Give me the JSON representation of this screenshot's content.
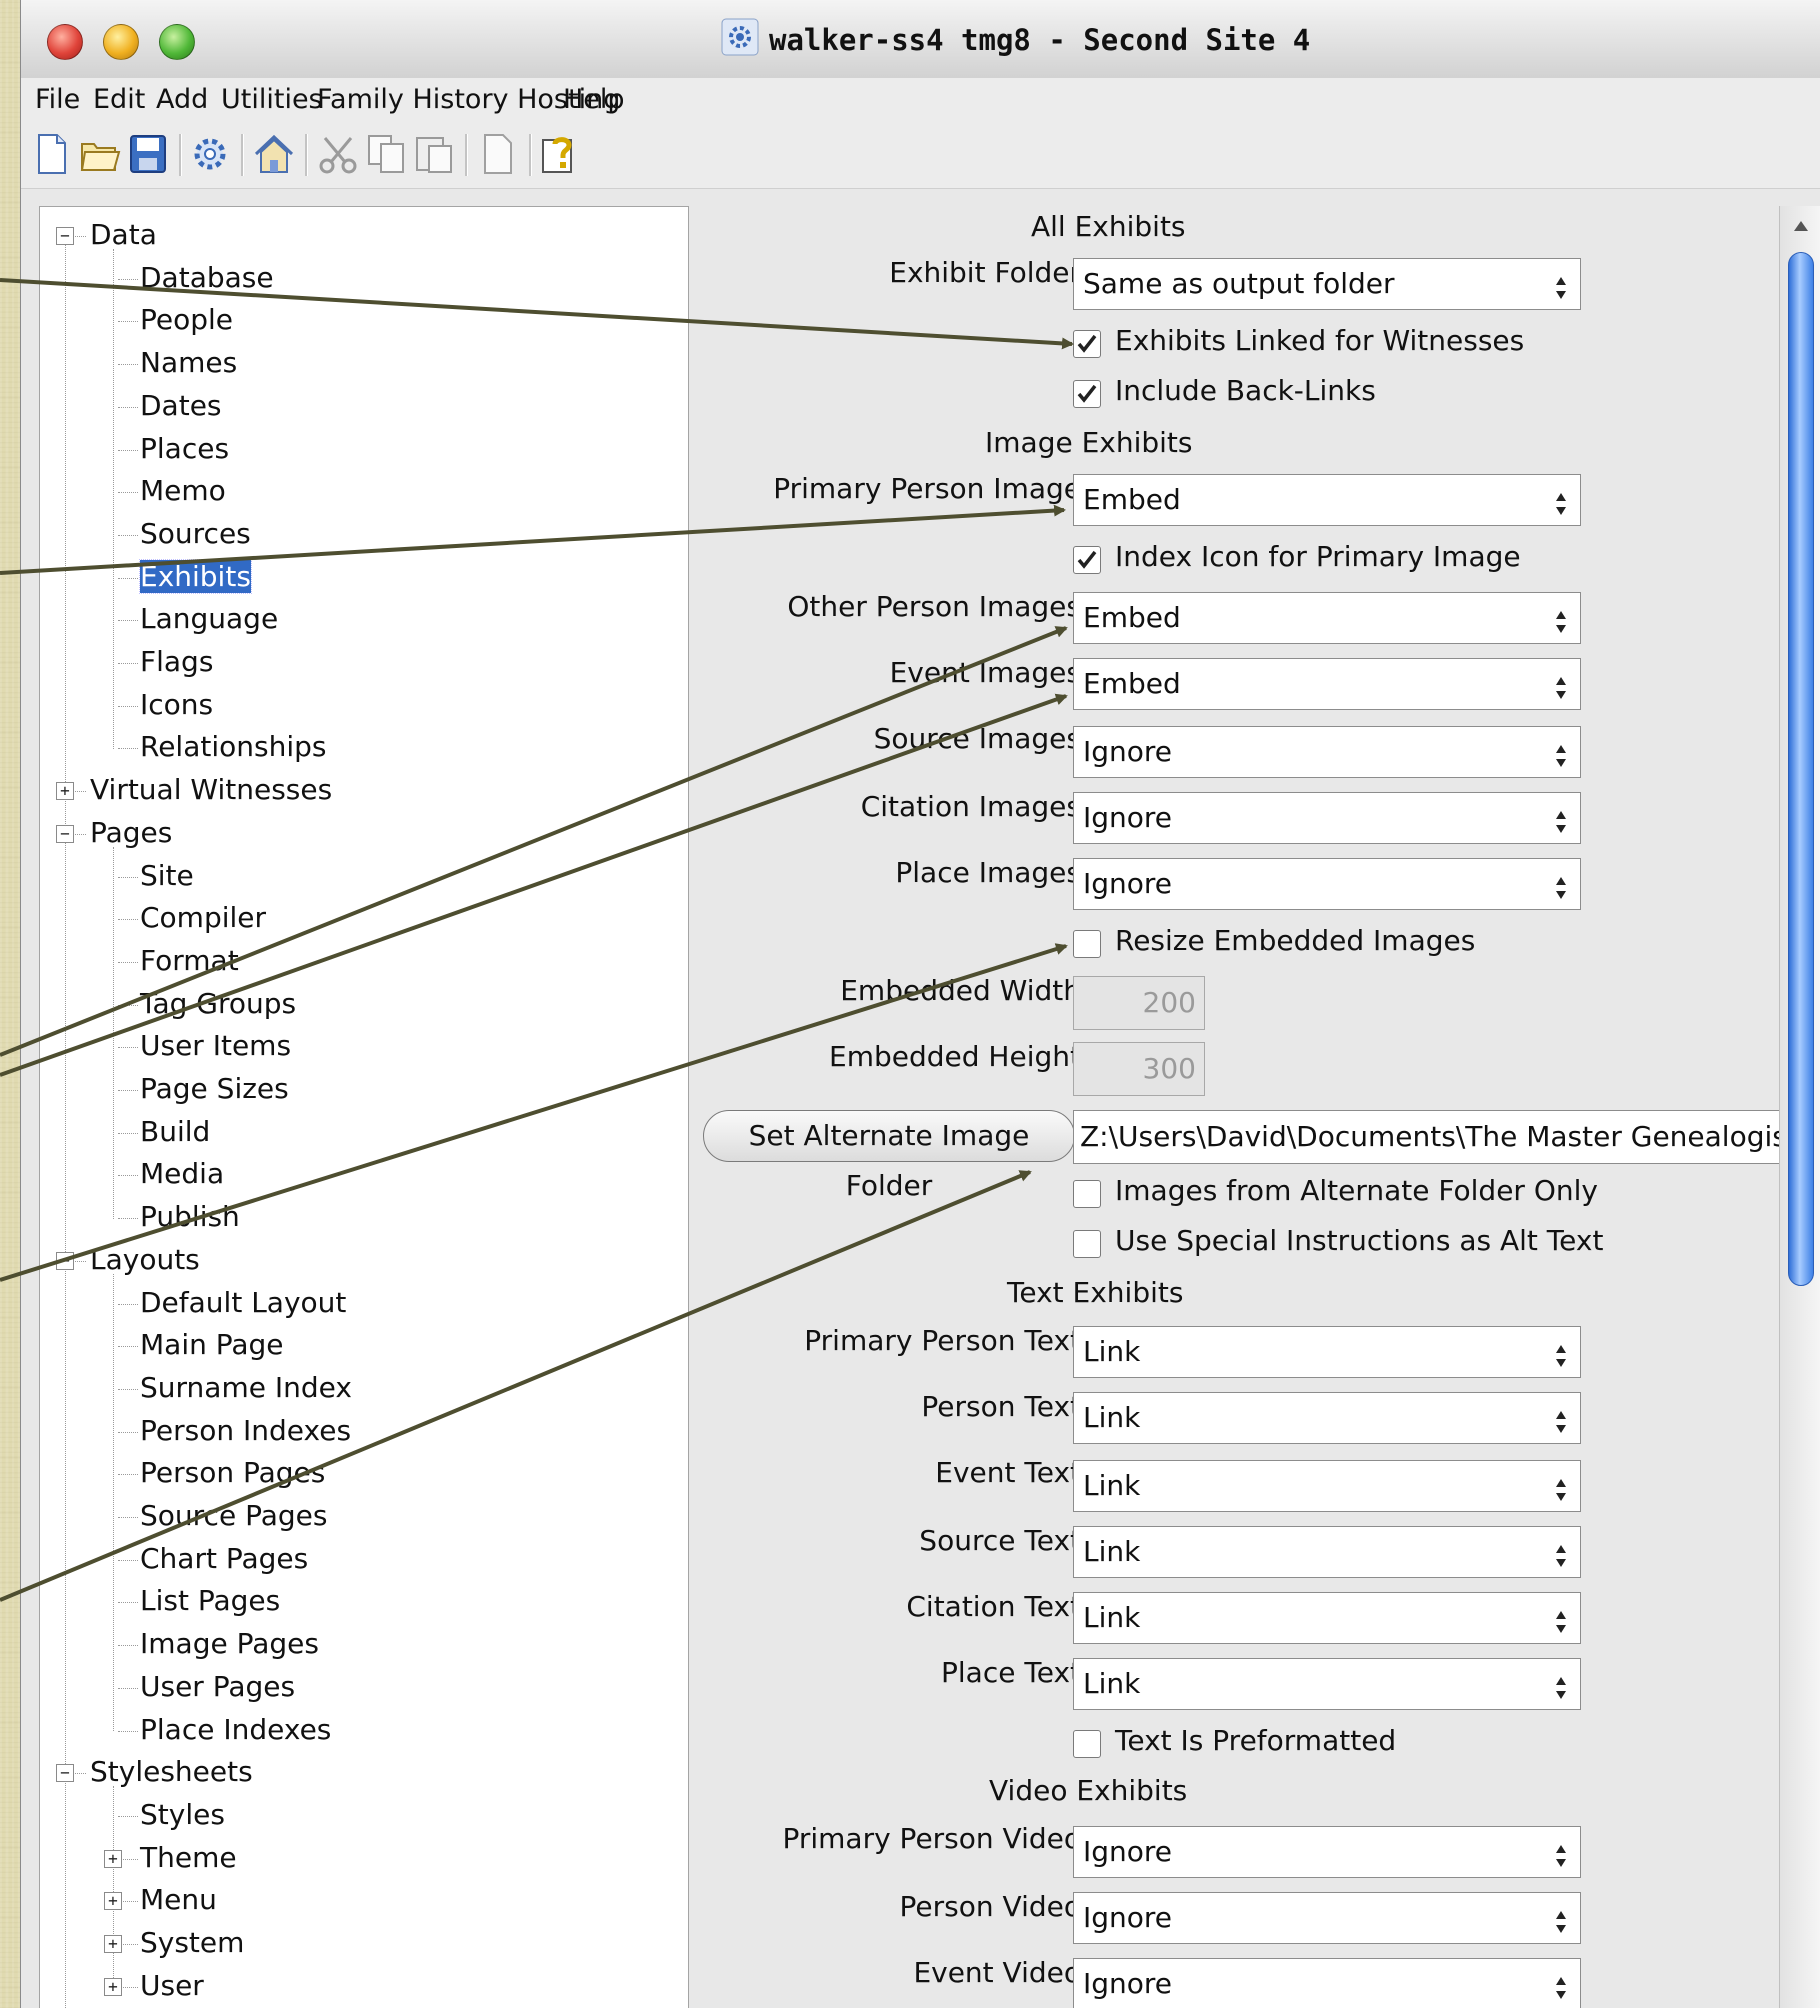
{
  "window": {
    "title": "walker-ss4 tmg8 - Second Site 4",
    "app_icon": "gear-app-icon"
  },
  "menu": [
    "File",
    "Edit",
    "Add",
    "Utilities",
    "Family History Hosting",
    "Help"
  ],
  "toolbar": [
    "new-document-icon",
    "open-folder-icon",
    "save-icon",
    "gear-icon",
    "home-icon",
    "cut-icon",
    "copy-icon",
    "paste-icon",
    "blank-page-icon",
    "help-icon"
  ],
  "tree": {
    "data": {
      "label": "Data",
      "children": [
        "Database",
        "People",
        "Names",
        "Dates",
        "Places",
        "Memo",
        "Sources",
        "Exhibits",
        "Language",
        "Flags",
        "Icons",
        "Relationships"
      ],
      "selected": "Exhibits"
    },
    "virtual_witnesses": "Virtual Witnesses",
    "pages": {
      "label": "Pages",
      "children": [
        "Site",
        "Compiler",
        "Format",
        "Tag Groups",
        "User Items",
        "Page Sizes",
        "Build",
        "Media",
        "Publish"
      ]
    },
    "layouts": {
      "label": "Layouts",
      "children": [
        "Default Layout",
        "Main Page",
        "Surname Index",
        "Person Indexes",
        "Person Pages",
        "Source Pages",
        "Chart Pages",
        "List Pages",
        "Image Pages",
        "User Pages",
        "Place Indexes"
      ]
    },
    "stylesheets": {
      "label": "Stylesheets",
      "children": [
        "Styles",
        "Theme",
        "Menu",
        "System",
        "User"
      ]
    }
  },
  "settings": {
    "all_exhibits_header": "All Exhibits",
    "exhibit_folder": {
      "label": "Exhibit Folder",
      "value": "Same as output folder"
    },
    "exhibits_linked_for_witnesses": {
      "label": "Exhibits Linked for Witnesses",
      "checked": true
    },
    "include_back_links": {
      "label": "Include Back-Links",
      "checked": true
    },
    "image_exhibits_header": "Image Exhibits",
    "primary_person_image": {
      "label": "Primary Person Image",
      "value": "Embed"
    },
    "index_icon_for_primary_image": {
      "label": "Index Icon for Primary Image",
      "checked": true
    },
    "other_person_images": {
      "label": "Other Person Images",
      "value": "Embed"
    },
    "event_images": {
      "label": "Event Images",
      "value": "Embed"
    },
    "source_images": {
      "label": "Source Images",
      "value": "Ignore"
    },
    "citation_images": {
      "label": "Citation Images",
      "value": "Ignore"
    },
    "place_images": {
      "label": "Place Images",
      "value": "Ignore"
    },
    "resize_embedded_images": {
      "label": "Resize Embedded Images",
      "checked": false
    },
    "embedded_width": {
      "label": "Embedded Width",
      "value": "200"
    },
    "embedded_height": {
      "label": "Embedded Height",
      "value": "300"
    },
    "alternate_folder_button": "Set Alternate Image Folder",
    "alternate_folder_path": "Z:\\Users\\David\\Documents\\The Master Genealogist",
    "images_from_alternate_folder_only": {
      "label": "Images from Alternate Folder Only",
      "checked": false
    },
    "use_special_instructions_alt_text": {
      "label": "Use Special Instructions as Alt Text",
      "checked": false
    },
    "text_exhibits_header": "Text Exhibits",
    "primary_person_text": {
      "label": "Primary Person Text",
      "value": "Link"
    },
    "person_text": {
      "label": "Person Text",
      "value": "Link"
    },
    "event_text": {
      "label": "Event Text",
      "value": "Link"
    },
    "source_text": {
      "label": "Source Text",
      "value": "Link"
    },
    "citation_text": {
      "label": "Citation Text",
      "value": "Link"
    },
    "place_text": {
      "label": "Place Text",
      "value": "Link"
    },
    "text_is_preformatted": {
      "label": "Text Is Preformatted",
      "checked": false
    },
    "video_exhibits_header": "Video Exhibits",
    "primary_person_video": {
      "label": "Primary Person Video",
      "value": "Ignore"
    },
    "person_video": {
      "label": "Person Video",
      "value": "Ignore"
    },
    "event_video": {
      "label": "Event Video",
      "value": "Ignore"
    }
  },
  "colors": {
    "selection": "#316ac5",
    "annotation_arrow": "#4e4e30",
    "scroll_thumb": "#3d80e6"
  }
}
